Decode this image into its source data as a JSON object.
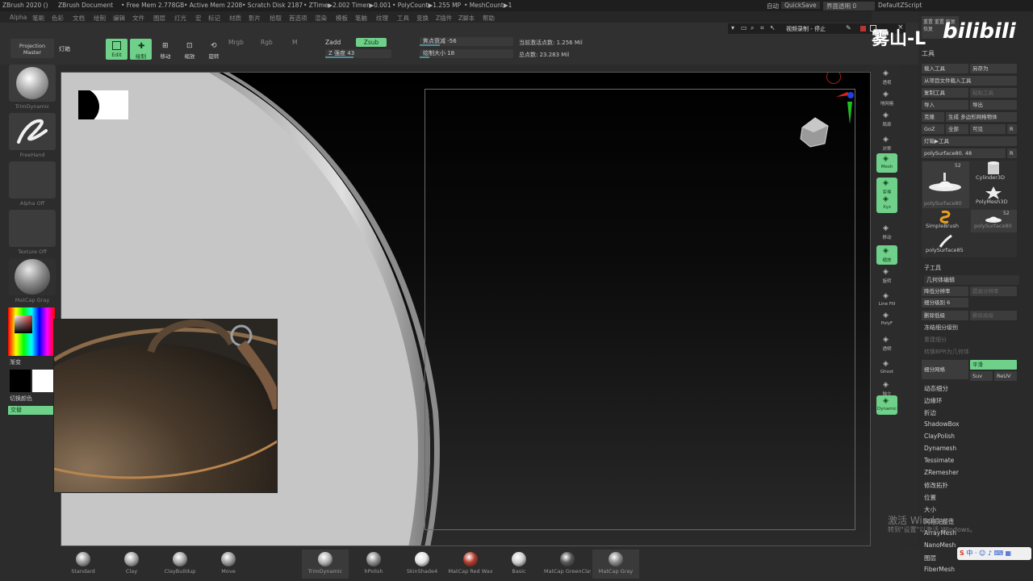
{
  "title_bar": {
    "app": "ZBrush 2020 ()",
    "document": "ZBrush Document",
    "free_mem": "• Free Mem 2.778GB",
    "active_mem": "• Active Mem 2208",
    "scratch": "• Scratch Disk 2187",
    "ztime": "• ZTime▶2.002 Timer▶0.001",
    "polycount": "• PolyCount▶1.255 MP",
    "meshcount": "• MeshCount▶1",
    "autosave": "自动",
    "quicksave": "QuickSave",
    "transparency": "界面透明 0",
    "script": "DefaultZScript"
  },
  "menu_bar": [
    "Alpha",
    "笔刷",
    "色彩",
    "文档",
    "绘制",
    "编辑",
    "文件",
    "图层",
    "灯光",
    "宏",
    "标记",
    "材质",
    "影片",
    "拾取",
    "首选项",
    "渲染",
    "模板",
    "笔触",
    "纹理",
    "工具",
    "变换",
    "Z插件",
    "Z脚本",
    "帮助"
  ],
  "top_shelf": {
    "projection_master": "Projection Master",
    "lightbox": "灯箱",
    "edit": "Edit",
    "draw": "绘制",
    "move": "移动",
    "scale": "缩放",
    "rotate": "旋转",
    "mrgb": "Mrgb",
    "rgb": "Rgb",
    "m": "M",
    "zadd": "Zadd",
    "zsub": "Zsub",
    "z_intensity": "Z 强度 43",
    "focal_shift": "焦点衰减 -56",
    "draw_size": "绘制大小 18",
    "active_points": "当前激活点数: 1.256 Mil",
    "total_points": "总点数: 23.283 Mil"
  },
  "left_panel": {
    "brush1": "TrimDynamic",
    "brush2": "FreeHand",
    "alpha": "Alpha Off",
    "texture": "Texture Off",
    "material": "MatCap Gray",
    "gradient": "渐变",
    "switch_color": "切换颜色",
    "alternate": "交替"
  },
  "recording": {
    "label": "视频录制 - 停止"
  },
  "watermark": {
    "text": "雾山-L",
    "logo": "bilibili",
    "activate1": "激活 Windows",
    "activate2": "转到\"设置\"以激活 Windows。"
  },
  "right_strip": [
    "透视",
    "地网格",
    "局部",
    "对称",
    "Mesh",
    "变换",
    "Xyz",
    "移动",
    "缩放",
    "旋转",
    "Line Fill",
    "PolyF",
    "透明",
    "Ghost",
    "独立",
    "Dynamic"
  ],
  "right_panel": {
    "header": "工具",
    "load_tool": "载入工具",
    "save_as": "另存为",
    "load_from_project": "从项目文件载入工具",
    "copy_tool": "复制工具",
    "paste_tool": "粘贴工具",
    "import": "导入",
    "export": "导出",
    "clone": "克隆",
    "make_polymesh": "生成 多边形网格物体",
    "goz": "GoZ",
    "all": "全部",
    "visible": "可见",
    "r": "R",
    "lightbox_tool": "灯箱▶工具",
    "current_tool": "polySurface80. 48",
    "tools": [
      {
        "name": "polySurface80",
        "count": "52"
      },
      {
        "name": "Cylinder3D"
      },
      {
        "name": "PolyMesh3D"
      },
      {
        "name": "SimpleBrush"
      },
      {
        "name": "polySurface80",
        "count": "52"
      },
      {
        "name": "polySurface85"
      }
    ],
    "subtool": "子工具",
    "geometry": "几何体编辑",
    "lower_res": "降低分辨率",
    "higher_res": "提高分辨率",
    "sdiv": "细分级别 6",
    "del_lower": "删除低级",
    "del_higher": "删除高级",
    "freeze_sdiv": "冻结细分级别",
    "reconstruct": "重建细分",
    "convert_bpr": "转换BPR为几何体",
    "divide": "细分网格",
    "smooth": "平滑",
    "suv": "Suv",
    "reuv": "ReUV",
    "items": [
      "动态细分",
      "边缘环",
      "折边",
      "ShadowBox",
      "ClayPolish",
      "Dynamesh",
      "Tessimate",
      "ZRemesher",
      "修改拓扑",
      "位置",
      "大小",
      "网格完整性",
      "ArrayMesh",
      "NanoMesh",
      "图层",
      "FiberMesh"
    ]
  },
  "bottom_shelf": [
    {
      "name": "Standard",
      "color": "#9a9a9a"
    },
    {
      "name": "Clay",
      "color": "#a8a8a8"
    },
    {
      "name": "ClayBuildup",
      "color": "#a8a8a8"
    },
    {
      "name": "Move",
      "color": "#9e9e9e"
    },
    {
      "name": "TrimDynamic",
      "color": "#b5b5b5"
    },
    {
      "name": "hPolish",
      "color": "#8d8d8d"
    },
    {
      "name": "SkinShade4",
      "color": "#e4e4e4"
    },
    {
      "name": "MatCap Red Wax",
      "color": "#b33a28"
    },
    {
      "name": "Basic",
      "color": "#cfcfcf"
    },
    {
      "name": "MatCap GreenClay",
      "color": "#555"
    },
    {
      "name": "MatCap Gray",
      "color": "#8a8a8a"
    }
  ],
  "colors": {
    "accent": "#6fd08a",
    "panel": "#2c2c2c"
  }
}
